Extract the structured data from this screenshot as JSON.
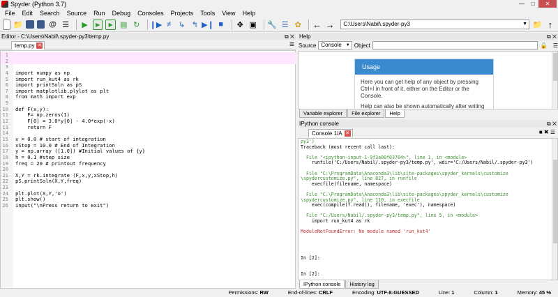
{
  "window": {
    "title": "Spyder (Python 3.7)"
  },
  "menu": [
    "File",
    "Edit",
    "Search",
    "Source",
    "Run",
    "Debug",
    "Consoles",
    "Projects",
    "Tools",
    "View",
    "Help"
  ],
  "toolbar": {
    "path": "C:\\Users\\Nabil\\.spyder-py3"
  },
  "editor": {
    "pane_title": "Editor - C:\\Users\\Nabil\\.spyder-py3\\temp.py",
    "tab": "temp.py",
    "lines": [
      {
        "n": "1",
        "t": ""
      },
      {
        "n": "2",
        "t": ""
      },
      {
        "n": "3",
        "t": ""
      },
      {
        "n": "4",
        "t": "import numpy as np"
      },
      {
        "n": "5",
        "t": "import run_kut4 as rk"
      },
      {
        "n": "6",
        "t": "import printSoln as pS"
      },
      {
        "n": "7",
        "t": "import matplotlib.plylot as plt"
      },
      {
        "n": "8",
        "t": "from math import exp"
      },
      {
        "n": "9",
        "t": ""
      },
      {
        "n": "10",
        "t": "def F(x,y):"
      },
      {
        "n": "11",
        "t": "    F= np.zeros(1)"
      },
      {
        "n": "12",
        "t": "    F[0] = 3.0*y[0] - 4.0*exp(-x)"
      },
      {
        "n": "13",
        "t": "    return F"
      },
      {
        "n": "14",
        "t": ""
      },
      {
        "n": "15",
        "t": "x = 0.0 # start of integration"
      },
      {
        "n": "16",
        "t": "xStop = 10.0 # End of Integration"
      },
      {
        "n": "17",
        "t": "y = np.array ([1.0]) #Initial values of {y}"
      },
      {
        "n": "18",
        "t": "h = 0.1 #step size"
      },
      {
        "n": "19",
        "t": "freq = 20 # printout frequency"
      },
      {
        "n": "20",
        "t": ""
      },
      {
        "n": "21",
        "t": "X,Y = rk.integrate (F,x,y,xStop,h)"
      },
      {
        "n": "22",
        "t": "pS.printSoln(X,Y,freq)"
      },
      {
        "n": "23",
        "t": ""
      },
      {
        "n": "24",
        "t": "plt.plot(X,Y,'o')"
      },
      {
        "n": "25",
        "t": "plt.show()"
      },
      {
        "n": "26",
        "t": "input(\"\\nPress return to exit\")"
      }
    ]
  },
  "help": {
    "pane_title": "Help",
    "source_label": "Source",
    "source_value": "Console",
    "object_label": "Object",
    "usage_title": "Usage",
    "usage_text_1": "Here you can get help of any object by pressing",
    "usage_text_2": "Ctrl+I in front of it, either on the Editor or the",
    "usage_text_3": "Console.",
    "usage_text_4": "Help can also be shown automatically after writing a",
    "tabs": [
      "Variable explorer",
      "File explorer",
      "Help"
    ]
  },
  "console": {
    "pane_title": "IPython console",
    "tab": "Console 1/A",
    "lines": [
      "py3')",
      "Traceback (most recent call last):",
      "",
      "  File \"<ipython-input-1-9f3a00f03704>\", line 1, in <module>",
      "    runfile('C:/Users/Nabil/.spyder-py3/temp.py', wdir='C:/Users/Nabil/.spyder-py3')",
      "",
      "  File \"C:\\ProgramData\\Anaconda3\\lib\\site-packages\\spyder_kernels\\customize",
      "\\spydercustomize.py\", line 827, in runfile",
      "    execfile(filename, namespace)",
      "",
      "  File \"C:\\ProgramData\\Anaconda3\\lib\\site-packages\\spyder_kernels\\customize",
      "\\spydercustomize.py\", line 110, in execfile",
      "    exec(compile(f.read(), filename, 'exec'), namespace)",
      "",
      "  File \"C:/Users/Nabil/.spyder-py3/temp.py\", line 5, in <module>",
      "    import run_kut4 as rk",
      "",
      "ModuleNotFoundError: No module named 'run_kut4'",
      "",
      "",
      "",
      "",
      "In [2]:",
      "",
      "",
      "In [2]:"
    ],
    "tabs": [
      "IPython console",
      "History log"
    ]
  },
  "status": {
    "permissions_label": "Permissions:",
    "permissions": "RW",
    "eol_label": "End-of-lines:",
    "eol": "CRLF",
    "encoding_label": "Encoding:",
    "encoding": "UTF-8-GUESSED",
    "line_label": "Line:",
    "line": "1",
    "column_label": "Column:",
    "column": "1",
    "memory_label": "Memory:",
    "memory": "45 %"
  }
}
